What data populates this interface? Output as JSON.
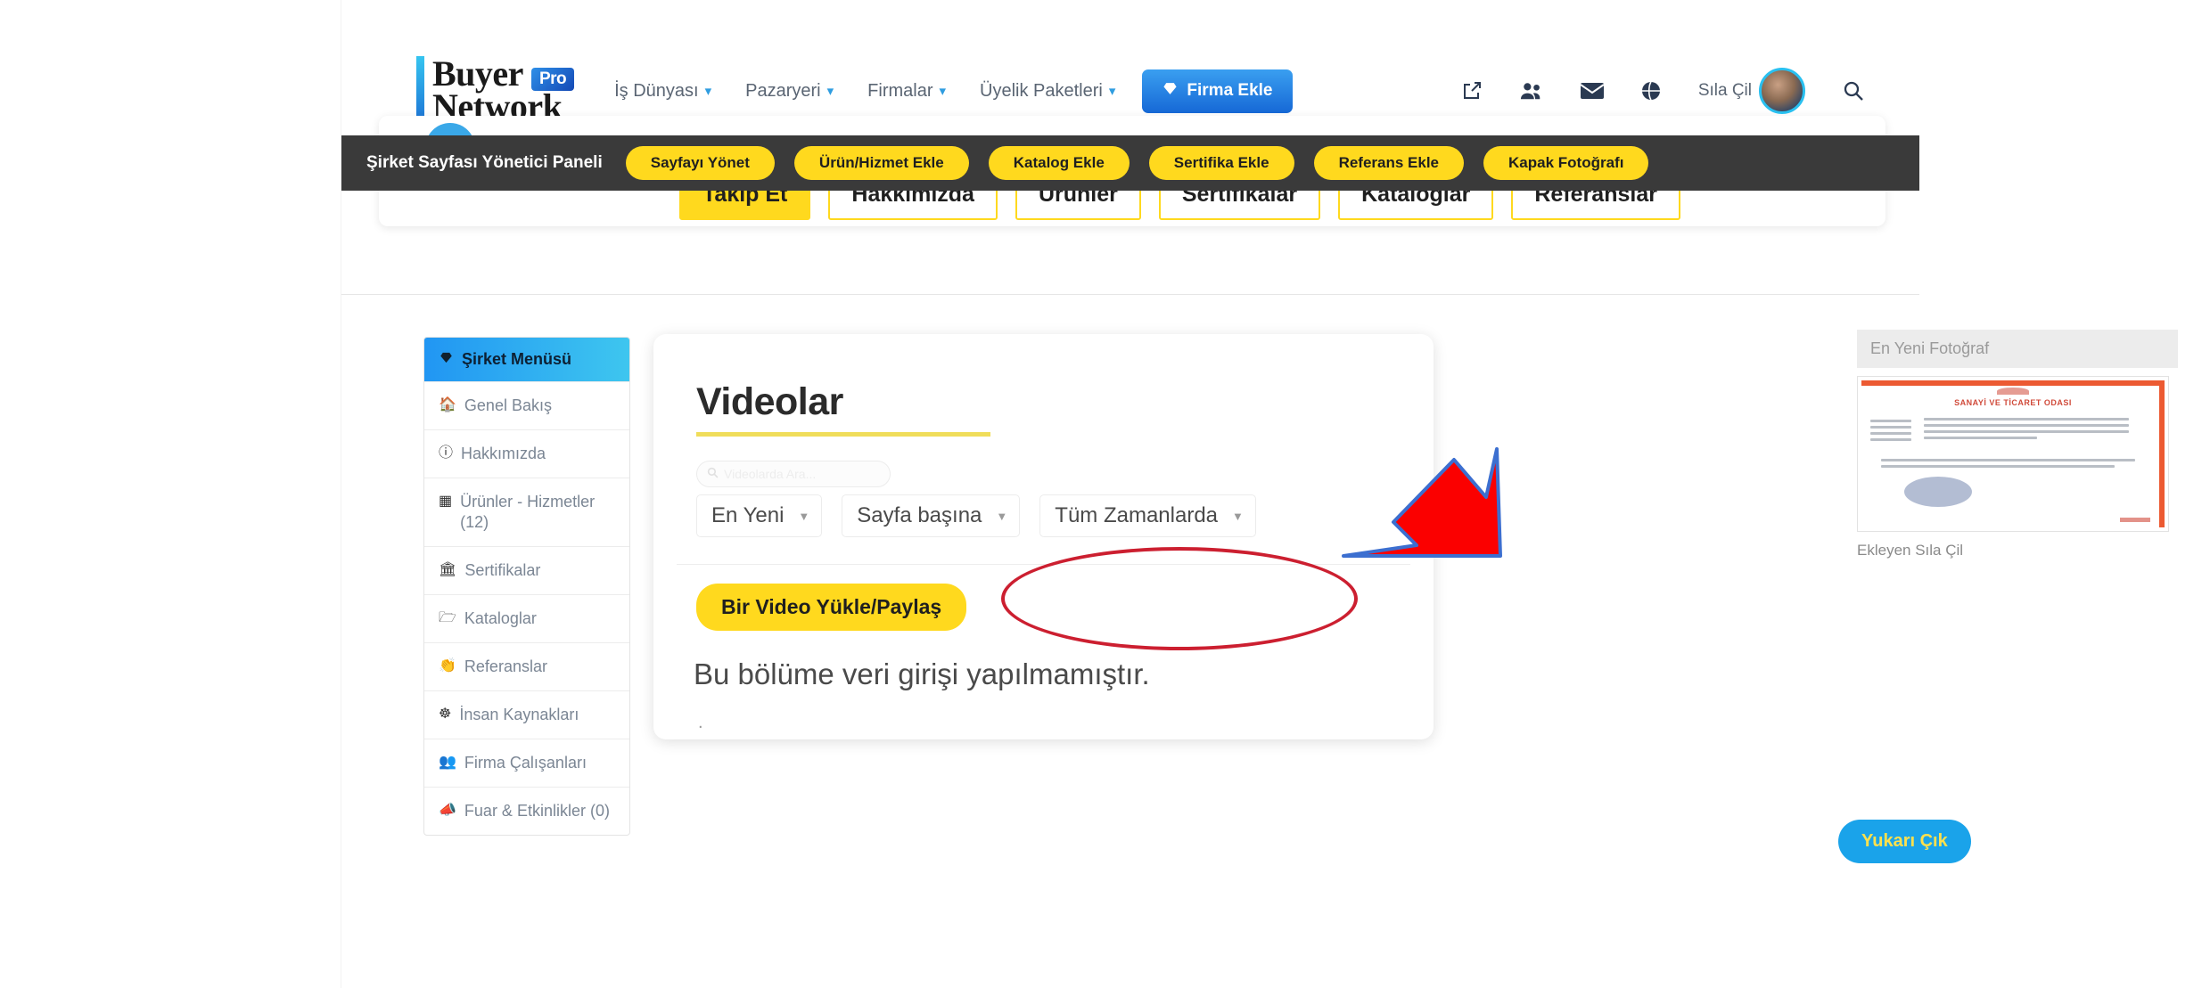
{
  "brand": {
    "line1": "Buyer",
    "line2": "Network",
    "badge": "Pro"
  },
  "header": {
    "nav": [
      {
        "label": "İş Dünyası",
        "has_caret": true,
        "icon": "chevron-down-icon"
      },
      {
        "label": "Pazaryeri",
        "has_caret": true,
        "icon": "chevron-down-icon"
      },
      {
        "label": "Firmalar",
        "has_caret": true,
        "icon": "chevron-down-icon"
      },
      {
        "label": "Üyelik Paketleri",
        "has_caret": true,
        "icon": "chevron-down-icon"
      }
    ],
    "cta": {
      "label": "Firma Ekle",
      "icon": "diamond-icon",
      "color": "#2077dd"
    },
    "icons": [
      "external-link-icon",
      "users-group-icon",
      "envelope-icon",
      "globe-icon"
    ],
    "user_name": "Sıla Çil",
    "avatar": "user-avatar",
    "search_icon": "search-icon"
  },
  "adminbar": {
    "title": "Şirket Sayfası Yönetici Paneli",
    "buttons": [
      "Sayfayı Yönet",
      "Ürün/Hizmet Ekle",
      "Katalog Ekle",
      "Sertifika Ekle",
      "Referans Ekle",
      "Kapak Fotoğrafı"
    ],
    "bg": "#3a3a3a",
    "pill_color": "#ffd91e"
  },
  "profile_tabs": [
    {
      "label": "Takip Et",
      "active": true
    },
    {
      "label": "Hakkımızda",
      "active": false
    },
    {
      "label": "Ürünler",
      "active": false
    },
    {
      "label": "Sertifikalar",
      "active": false
    },
    {
      "label": "Kataloglar",
      "active": false
    },
    {
      "label": "Referanslar",
      "active": false
    }
  ],
  "sidebar": {
    "header": {
      "label": "Şirket Menüsü",
      "icon": "diamond-icon"
    },
    "items": [
      {
        "label": "Genel Bakış",
        "icon": "home-icon"
      },
      {
        "label": "Hakkımızda",
        "icon": "info-icon"
      },
      {
        "label": "Ürünler - Hizmetler (12)",
        "icon": "grid-icon"
      },
      {
        "label": "Sertifikalar",
        "icon": "bank-icon"
      },
      {
        "label": "Kataloglar",
        "icon": "folder-icon"
      },
      {
        "label": "Referanslar",
        "icon": "handshake-icon"
      },
      {
        "label": "İnsan Kaynakları",
        "icon": "sitemap-icon"
      },
      {
        "label": "Firma Çalışanları",
        "icon": "users-group-icon"
      },
      {
        "label": "Fuar & Etkinlikler (0)",
        "icon": "megaphone-icon"
      }
    ]
  },
  "content": {
    "title": "Videolar",
    "search": {
      "placeholder": "Videolarda Ara...",
      "value": "",
      "icon": "search-icon"
    },
    "filters": [
      {
        "name": "sort",
        "value": "En Yeni"
      },
      {
        "name": "per-page",
        "value": "Sayfa başına"
      },
      {
        "name": "time-range",
        "value": "Tüm Zamanlarda"
      }
    ],
    "upload_button": "Bir Video Yükle/Paylaş",
    "empty_message": "Bu bölüme veri girişi yapılmamıştır.",
    "trailing_mark": "."
  },
  "right_panel": {
    "header": "En Yeni Fotoğraf",
    "caption": "Ekleyen Sıla Çil",
    "image_alt": "certificate-photo"
  },
  "scroll_top": {
    "label": "Yukarı Çık",
    "bg": "#1aa3ea",
    "fg": "#ffe14d"
  },
  "annotations": {
    "highlight_ellipse": "red-ellipse-around-upload-button",
    "pointer_arrow": "red-arrow-pointing-to-upload-button",
    "color": "#cc1f30"
  }
}
